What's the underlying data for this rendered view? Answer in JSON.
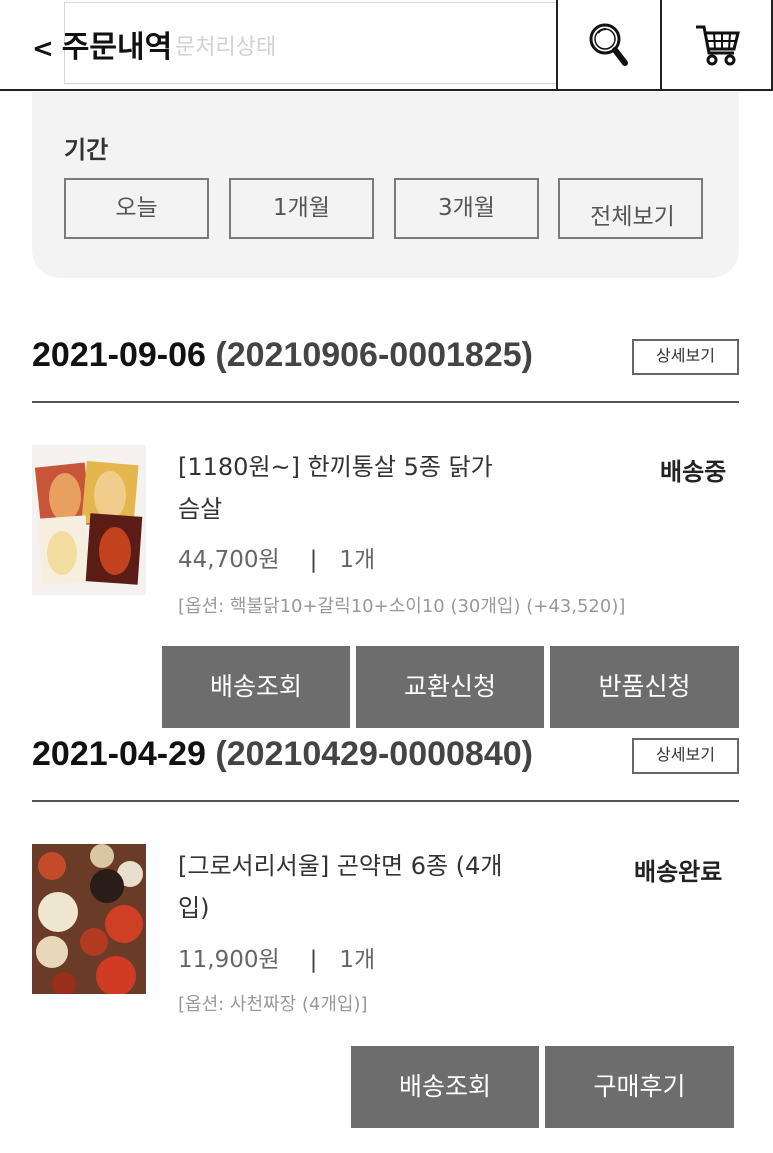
{
  "header": {
    "back_glyph": "<",
    "title": "주문내역",
    "status_placeholder": "문처리상태",
    "search_icon": "search-icon",
    "cart_icon": "cart-icon"
  },
  "period": {
    "label": "기간",
    "options": [
      "오늘",
      "1개월",
      "3개월",
      "전체보기"
    ]
  },
  "orders": [
    {
      "date": "2021-09-06",
      "order_no": "(20210906-0001825)",
      "detail_label": "상세보기",
      "product": {
        "name": "[1180원~] 한끼통살 5종 닭가슴살",
        "status": "배송중",
        "price": "44,700원",
        "separator": "|",
        "quantity": "1개",
        "option": "[옵션: 핵불닭10+갈릭10+소이10 (30개입) (+43,520)]"
      },
      "actions": [
        "배송조회",
        "교환신청",
        "반품신청"
      ]
    },
    {
      "date": "2021-04-29",
      "order_no": "(20210429-0000840)",
      "detail_label": "상세보기",
      "product": {
        "name": "[그로서리서울] 곤약면 6종 (4개입)",
        "status": "배송완료",
        "price": "11,900원",
        "separator": "|",
        "quantity": "1개",
        "option": "[옵션: 사천짜장 (4개입)]"
      },
      "actions": [
        "배송조회",
        "구매후기"
      ]
    }
  ],
  "colors": {
    "action_button": "#6d6d6d",
    "panel_bg": "#f3f3f3",
    "divider": "#555555"
  }
}
